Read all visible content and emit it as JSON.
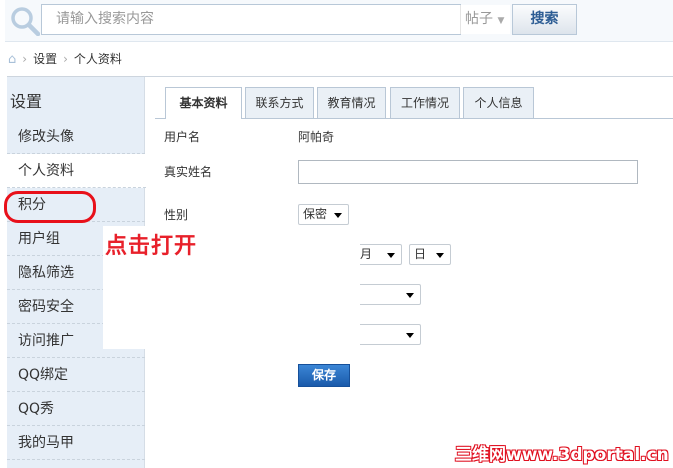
{
  "search": {
    "placeholder": "请输入搜索内容",
    "scope": "帖子",
    "button": "搜索"
  },
  "breadcrumb": [
    "设置",
    "个人资料"
  ],
  "sidebar": {
    "title": "设置",
    "items": [
      "修改头像",
      "个人资料",
      "积分",
      "用户组",
      "隐私筛选",
      "密码安全",
      "访问推广",
      "QQ绑定",
      "QQ秀",
      "我的马甲"
    ],
    "active": 1
  },
  "tabs": [
    "基本资料",
    "联系方式",
    "教育情况",
    "工作情况",
    "个人信息"
  ],
  "form": {
    "username_label": "用户名",
    "username_value": "阿帕奇",
    "realname_label": "真实姓名",
    "realname_value": "",
    "gender_label": "性别",
    "gender_value": "保密",
    "month": "月",
    "day": "日",
    "save": "保存"
  },
  "annotation": "点击打开",
  "watermark": "三维网www.3dportal.cn",
  "colors": {
    "accent": "#1a5aaa",
    "annotation": "#e8202a"
  }
}
